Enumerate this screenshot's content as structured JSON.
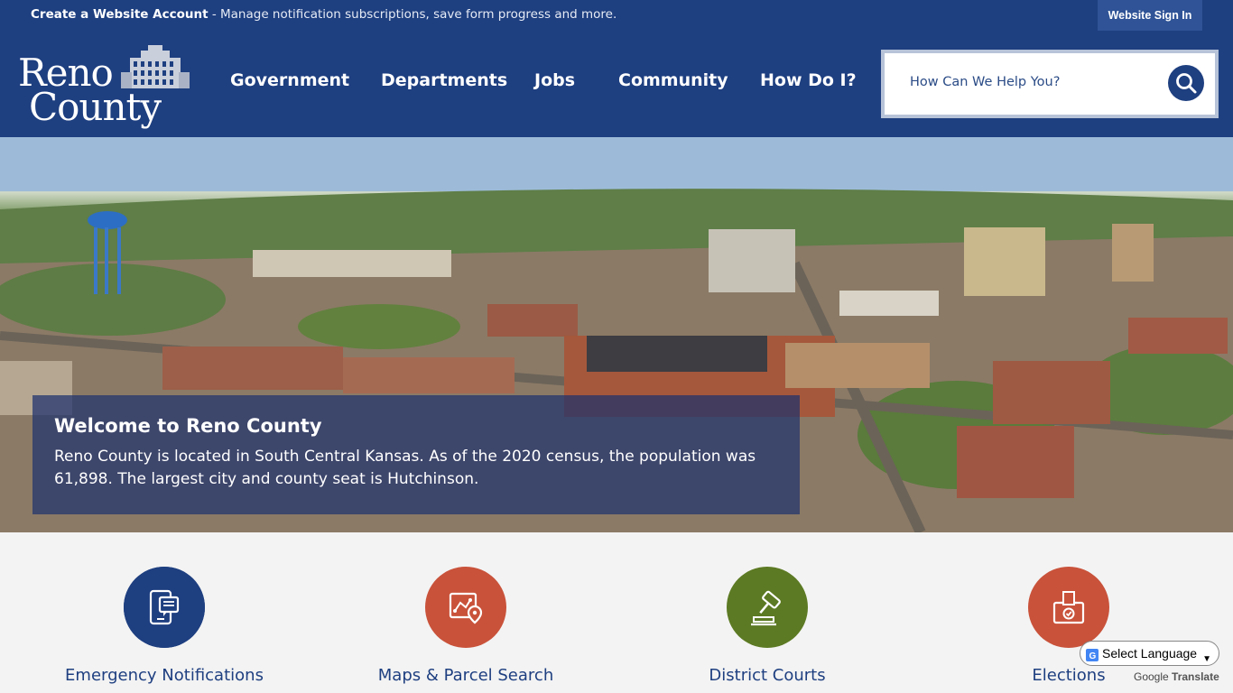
{
  "topbar": {
    "create_account": "Create a Website Account",
    "create_desc": " - Manage notification subscriptions, save form progress and more.",
    "sign_in": "Website Sign In"
  },
  "logo": {
    "line1": "Reno",
    "line2": "County"
  },
  "nav": [
    {
      "label": "Government"
    },
    {
      "label": "Departments"
    },
    {
      "label": "Jobs"
    },
    {
      "label": "Community"
    },
    {
      "label": "How Do I?"
    }
  ],
  "search": {
    "placeholder": "How Can We Help You?"
  },
  "hero": {
    "title": "Welcome to Reno County",
    "text": "Reno County is located in South Central Kansas. As of the 2020 census, the population was 61,898. The largest city and county seat is Hutchinson."
  },
  "quick_links": [
    {
      "label": "Emergency Notifications",
      "icon": "mobile-message-icon",
      "color": "#1e3f80"
    },
    {
      "label": "Maps & Parcel Search",
      "icon": "map-pin-icon",
      "color": "#c9523a"
    },
    {
      "label": "District Courts",
      "icon": "gavel-icon",
      "color": "#5c7a23"
    },
    {
      "label": "Elections",
      "icon": "ballot-box-icon",
      "color": "#c9523a"
    }
  ],
  "translate": {
    "select_label": "Select Language",
    "powered_google": "Google",
    "powered_translate": "Translate"
  },
  "colors": {
    "brand": "#1e3f80",
    "accent_red": "#c9523a",
    "accent_green": "#5c7a23"
  }
}
